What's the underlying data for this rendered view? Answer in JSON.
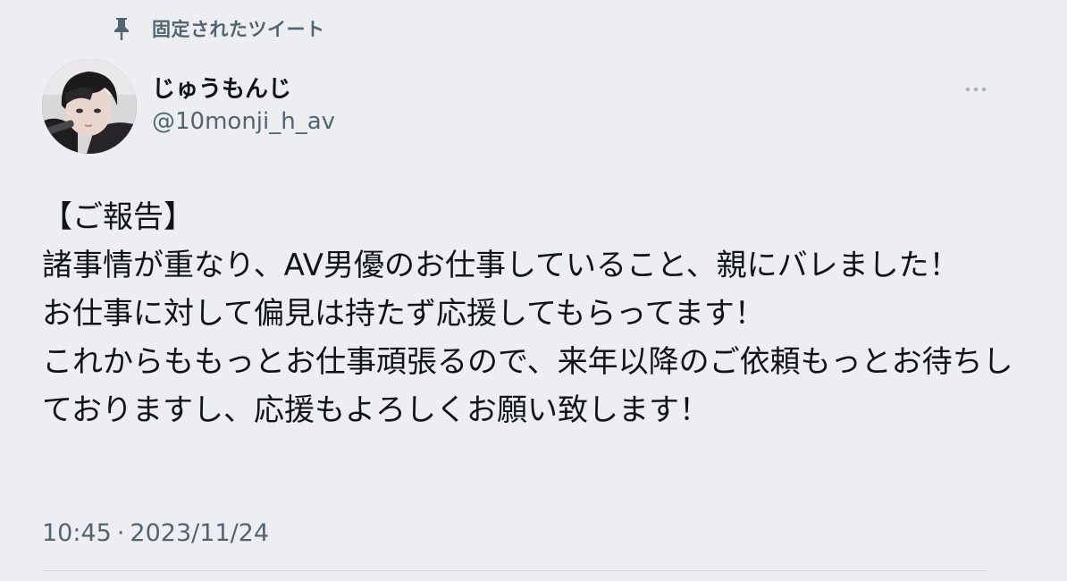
{
  "pinned": {
    "icon": "pin-icon",
    "label": "固定されたツイート"
  },
  "author": {
    "display_name": "じゅうもんじ",
    "handle": "@10monji_h_av",
    "avatar_icon": "avatar-photo"
  },
  "more_icon": "more-dots-icon",
  "tweet": {
    "text": "【ご報告】\n諸事情が重なり、AV男優のお仕事していること、親にバレました！\nお仕事に対して偏見は持たず応援してもらってます！\nこれからももっとお仕事頑張るので、来年以降のご依頼もっとお待ちしておりますし、応援もよろしくお願い致します！",
    "time": "10:45",
    "separator": "·",
    "date": "2023/11/24"
  },
  "colors": {
    "background": "#eceef1",
    "primary_text": "#0f1419",
    "secondary_text": "#536471"
  }
}
